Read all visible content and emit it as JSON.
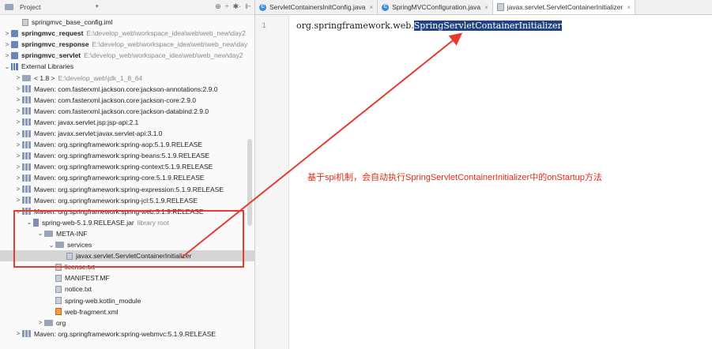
{
  "project_panel": {
    "title": "Project",
    "dropdown": "▾",
    "tools": [
      "⊕",
      "÷",
      "✱·",
      "⊩"
    ]
  },
  "tree": [
    {
      "indent": 1,
      "arrow": "",
      "icon": "file",
      "label": "springmvc_base_config.iml",
      "path": "",
      "bold": false
    },
    {
      "indent": 0,
      "arrow": ">",
      "icon": "mod",
      "label": "springmvc_request",
      "path": "E:\\develop_web\\workspace_idea\\web\\web_new\\day2",
      "bold": true
    },
    {
      "indent": 0,
      "arrow": ">",
      "icon": "mod",
      "label": "springmvc_response",
      "path": "E:\\develop_web\\workspace_idea\\web\\web_new\\day",
      "bold": true
    },
    {
      "indent": 0,
      "arrow": ">",
      "icon": "mod",
      "label": "springmvc_servlet",
      "path": "E:\\develop_web\\workspace_idea\\web\\web_new\\day2",
      "bold": true
    },
    {
      "indent": 0,
      "arrow": "⌄",
      "icon": "extlib",
      "label": "External Libraries",
      "path": "",
      "bold": false
    },
    {
      "indent": 1,
      "arrow": ">",
      "icon": "folder",
      "label": "< 1.8 >",
      "path": "E:\\develop_web\\jdk_1_8_64",
      "bold": false
    },
    {
      "indent": 1,
      "arrow": ">",
      "icon": "lib",
      "label": "Maven: com.fasterxml.jackson.core:jackson-annotations:2.9.0",
      "path": "",
      "bold": false
    },
    {
      "indent": 1,
      "arrow": ">",
      "icon": "lib",
      "label": "Maven: com.fasterxml.jackson.core:jackson-core:2.9.0",
      "path": "",
      "bold": false
    },
    {
      "indent": 1,
      "arrow": ">",
      "icon": "lib",
      "label": "Maven: com.fasterxml.jackson.core:jackson-databind:2.9.0",
      "path": "",
      "bold": false
    },
    {
      "indent": 1,
      "arrow": ">",
      "icon": "lib",
      "label": "Maven: javax.servlet.jsp:jsp-api:2.1",
      "path": "",
      "bold": false
    },
    {
      "indent": 1,
      "arrow": ">",
      "icon": "lib",
      "label": "Maven: javax.servlet:javax.servlet-api:3.1.0",
      "path": "",
      "bold": false
    },
    {
      "indent": 1,
      "arrow": ">",
      "icon": "lib",
      "label": "Maven: org.springframework:spring-aop:5.1.9.RELEASE",
      "path": "",
      "bold": false
    },
    {
      "indent": 1,
      "arrow": ">",
      "icon": "lib",
      "label": "Maven: org.springframework:spring-beans:5.1.9.RELEASE",
      "path": "",
      "bold": false
    },
    {
      "indent": 1,
      "arrow": ">",
      "icon": "lib",
      "label": "Maven: org.springframework:spring-context:5.1.9.RELEASE",
      "path": "",
      "bold": false
    },
    {
      "indent": 1,
      "arrow": ">",
      "icon": "lib",
      "label": "Maven: org.springframework:spring-core:5.1.9.RELEASE",
      "path": "",
      "bold": false
    },
    {
      "indent": 1,
      "arrow": ">",
      "icon": "lib",
      "label": "Maven: org.springframework:spring-expression:5.1.9.RELEASE",
      "path": "",
      "bold": false
    },
    {
      "indent": 1,
      "arrow": ">",
      "icon": "lib",
      "label": "Maven: org.springframework:spring-jcl:5.1.9.RELEASE",
      "path": "",
      "bold": false
    },
    {
      "indent": 1,
      "arrow": "⌄",
      "icon": "lib",
      "label": "Maven: org.springframework:spring-web:5.1.9.RELEASE",
      "path": "",
      "bold": false
    },
    {
      "indent": 2,
      "arrow": "⌄",
      "icon": "jar",
      "label": "spring-web-5.1.9.RELEASE.jar",
      "path": "library root",
      "bold": false
    },
    {
      "indent": 3,
      "arrow": "⌄",
      "icon": "folder",
      "label": "META-INF",
      "path": "",
      "bold": false
    },
    {
      "indent": 4,
      "arrow": "⌄",
      "icon": "folder",
      "label": "services",
      "path": "",
      "bold": false
    },
    {
      "indent": 5,
      "arrow": "",
      "icon": "file",
      "label": "javax.servlet.ServletContainerInitializer",
      "path": "",
      "bold": false,
      "selected": true
    },
    {
      "indent": 4,
      "arrow": "",
      "icon": "file",
      "label": "license.txt",
      "path": "",
      "bold": false
    },
    {
      "indent": 4,
      "arrow": "",
      "icon": "file",
      "label": "MANIFEST.MF",
      "path": "",
      "bold": false
    },
    {
      "indent": 4,
      "arrow": "",
      "icon": "file",
      "label": "notice.txt",
      "path": "",
      "bold": false
    },
    {
      "indent": 4,
      "arrow": "",
      "icon": "file",
      "label": "spring-web.kotlin_module",
      "path": "",
      "bold": false
    },
    {
      "indent": 4,
      "arrow": "",
      "icon": "xml",
      "label": "web-fragment.xml",
      "path": "",
      "bold": false
    },
    {
      "indent": 3,
      "arrow": ">",
      "icon": "folder",
      "label": "org",
      "path": "",
      "bold": false
    },
    {
      "indent": 1,
      "arrow": ">",
      "icon": "lib",
      "label": "Maven: org.springframework:spring-webmvc:5.1.9.RELEASE",
      "path": "",
      "bold": false
    }
  ],
  "tabs": [
    {
      "label": "ServletContainersInitConfig.java",
      "icon": "C",
      "active": false
    },
    {
      "label": "SpringMVCConfiguration.java",
      "icon": "C",
      "active": false
    },
    {
      "label": "javax.servlet.ServletContainerInitializer",
      "icon": "file",
      "active": true
    }
  ],
  "tab_close": "×",
  "editor": {
    "line_number": "1",
    "code_prefix": "org.springframework.web.",
    "code_selected": "SpringServletContainerInitializer"
  },
  "annotation": "基于spi机制，会自动执行SpringServletContainerInitializer中的onStartup方法",
  "colors": {
    "annotation": "#e02b1a",
    "selection": "#214283"
  }
}
